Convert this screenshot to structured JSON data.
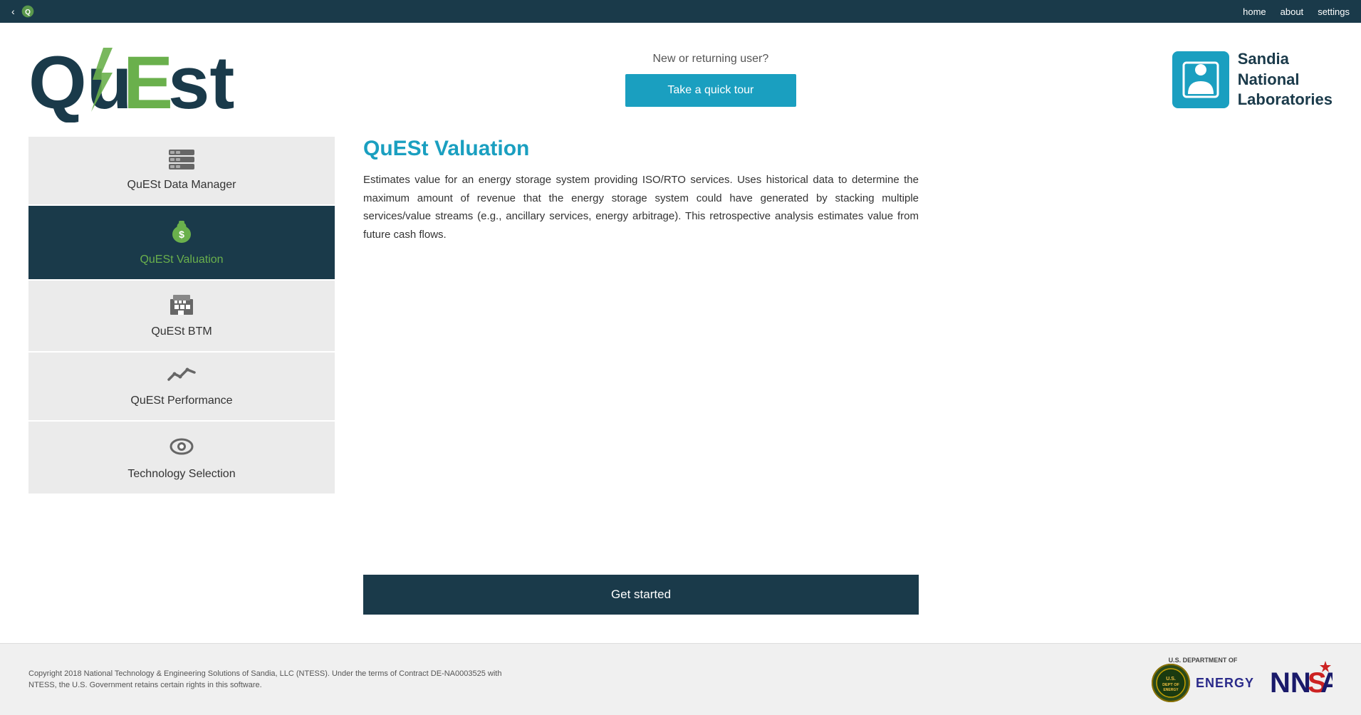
{
  "topbar": {
    "nav_items": [
      "home",
      "about",
      "settings"
    ]
  },
  "header": {
    "logo": "QuESt",
    "new_returning_text": "New or returning user?",
    "tour_button_label": "Take a quick tour",
    "sandia_name": "Sandia\nNational\nLaboratories"
  },
  "sidebar": {
    "items": [
      {
        "id": "data-manager",
        "label": "QuESt Data Manager",
        "icon": "data-manager-icon",
        "active": false
      },
      {
        "id": "valuation",
        "label": "QuESt Valuation",
        "icon": "valuation-icon",
        "active": true
      },
      {
        "id": "btm",
        "label": "QuESt BTM",
        "icon": "btm-icon",
        "active": false
      },
      {
        "id": "performance",
        "label": "QuESt Performance",
        "icon": "performance-icon",
        "active": false
      },
      {
        "id": "tech-selection",
        "label": "Technology Selection",
        "icon": "tech-selection-icon",
        "active": false
      }
    ]
  },
  "main": {
    "module_title": "QuESt Valuation",
    "module_description": "Estimates value for an energy storage system providing ISO/RTO services. Uses historical data  to determine  the  maximum  amount  of  revenue  that  the  energy  storage  system  could  have generated  by stacking multiple services/value streams (e.g., ancillary services, energy  arbitrage). This retrospective analysis estimates value from future cash flows.",
    "get_started_label": "Get started"
  },
  "footer": {
    "copyright_text": "Copyright 2018 National Technology & Engineering Solutions of Sandia, LLC (NTESS). Under the terms of Contract DE-NA0003525 with NTESS, the U.S. Government retains certain rights in this software.",
    "doe_label": "U.S. DEPARTMENT OF",
    "energy_label": "ENERGY",
    "nnsa_text": "NNSA"
  }
}
